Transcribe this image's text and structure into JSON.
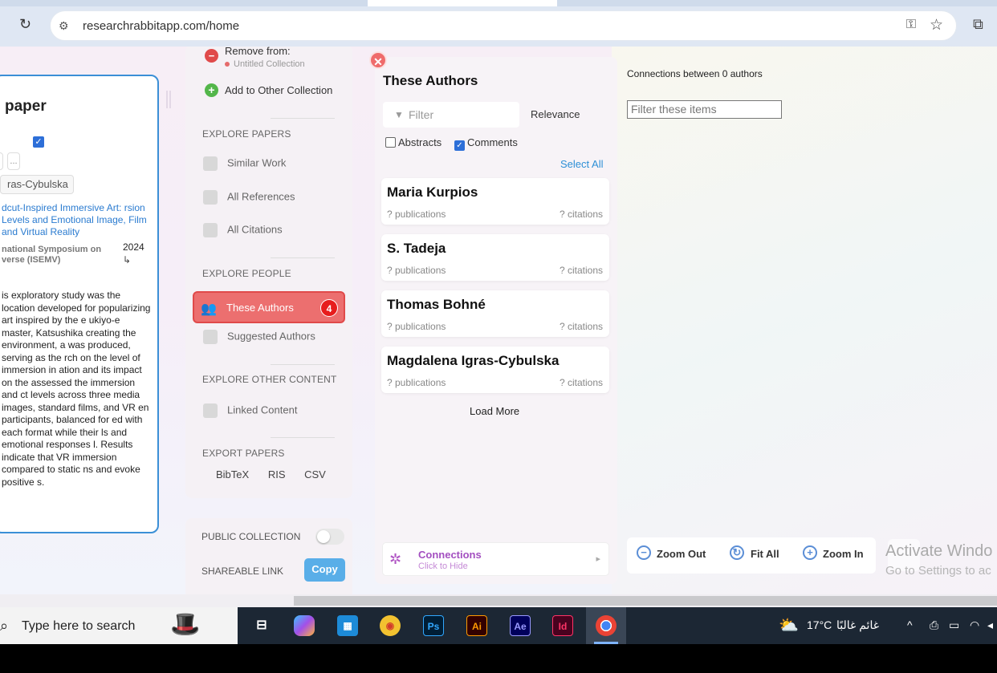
{
  "browser": {
    "url": "researchrabbitapp.com/home"
  },
  "paper_card": {
    "title_fragment": "paper",
    "chip_more": "...",
    "author_chip": "ras-Cybulska",
    "paper_title": "dcut-Inspired Immersive Art: rsion Levels and Emotional Image, Film and Virtual Reality",
    "venue": "national Symposium on verse (ISEMV)",
    "year": "2024",
    "arrow": "↳",
    "abstract": "is exploratory study was the location developed for popularizing art inspired by the e ukiyo-e master, Katsushika creating the environment, a was produced, serving as the rch on the level of immersion in ation and its impact on the assessed the immersion and ct levels across three media images, standard films, and VR en participants, balanced for ed with each format while their ls and emotional responses l. Results indicate that VR immersion compared to static ns and evoke positive s."
  },
  "menu": {
    "remove_from": "Remove from:",
    "remove_collection": "Untitled Collection",
    "add_other": "Add to Other Collection",
    "explore_papers": "EXPLORE PAPERS",
    "similar_work": "Similar Work",
    "all_references": "All References",
    "all_citations": "All Citations",
    "explore_people": "EXPLORE PEOPLE",
    "these_authors": "These Authors",
    "these_authors_count": "4",
    "suggested_authors": "Suggested Authors",
    "explore_other": "EXPLORE OTHER CONTENT",
    "linked_content": "Linked Content",
    "export_papers": "EXPORT PAPERS",
    "export_bibtex": "BibTeX",
    "export_ris": "RIS",
    "export_csv": "CSV",
    "public_collection": "PUBLIC COLLECTION",
    "shareable_link": "SHAREABLE LINK",
    "copy": "Copy"
  },
  "authors_panel": {
    "title": "These Authors",
    "filter_placeholder": "Filter",
    "sort": "Relevance",
    "abstracts_label": "Abstracts",
    "comments_label": "Comments",
    "select_all": "Select All",
    "authors": [
      {
        "name": "Maria Kurpios",
        "publications": "? publications",
        "citations": "? citations"
      },
      {
        "name": "S. Tadeja",
        "publications": "? publications",
        "citations": "? citations"
      },
      {
        "name": "Thomas Bohné",
        "publications": "? publications",
        "citations": "? citations"
      },
      {
        "name": "Magdalena Igras-Cybulska",
        "publications": "? publications",
        "citations": "? citations"
      }
    ],
    "load_more": "Load More",
    "connections_title": "Connections",
    "connections_sub": "Click to Hide"
  },
  "graph": {
    "connections_text": "Connections between 0 authors",
    "filter_placeholder": "Filter these items",
    "zoom_out": "Zoom Out",
    "fit_all": "Fit All",
    "zoom_in": "Zoom In"
  },
  "watermark": {
    "line1": "Activate Windo",
    "line2": "Go to Settings to ac"
  },
  "taskbar": {
    "search_placeholder": "Type here to search",
    "temperature": "17°C",
    "weather": "غائم غالبًا"
  },
  "colors": {
    "accent_red": "#ec6f6f",
    "link_blue": "#2d8fd6",
    "connections_purple": "#a34fc0"
  }
}
